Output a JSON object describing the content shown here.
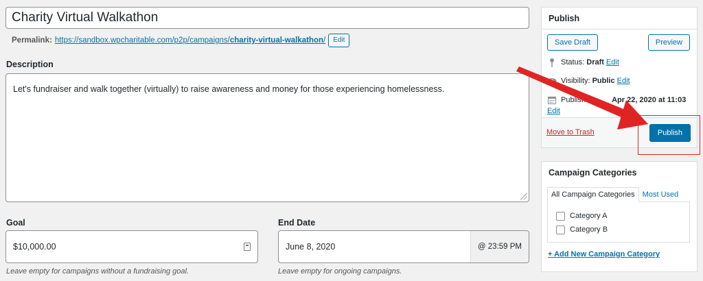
{
  "title": {
    "value": "Charity Virtual Walkathon"
  },
  "permalink": {
    "label": "Permalink:",
    "url_base": "https://sandbox.wpcharitable.com/p2p/campaigns/",
    "slug": "charity-virtual-walkathon",
    "url_trailing": "/",
    "edit_label": "Edit"
  },
  "description": {
    "label": "Description",
    "text": "Let's fundraiser and walk together (virtually) to raise awareness and money for those experiencing homelessness."
  },
  "goal": {
    "label": "Goal",
    "value": "$10,000.00",
    "hint": "Leave empty for campaigns without a fundraising goal."
  },
  "end_date": {
    "label": "End Date",
    "value": "June 8, 2020",
    "time": "@ 23:59 PM",
    "hint": "Leave empty for ongoing campaigns."
  },
  "publish": {
    "title": "Publish",
    "save_draft": "Save Draft",
    "preview": "Preview",
    "status_label": "Status:",
    "status_value": "Draft",
    "visibility_label": "Visibility:",
    "visibility_value": "Public",
    "published_label": "Publish",
    "published_value": "Apr 22, 2020 at 11:03",
    "edit": "Edit",
    "trash": "Move to Trash",
    "publish_button": "Publish"
  },
  "categories": {
    "title": "Campaign Categories",
    "tab_all": "All Campaign Categories",
    "tab_used": "Most Used",
    "items": [
      "Category A",
      "Category B"
    ],
    "add_new": "+ Add New Campaign Category"
  },
  "colors": {
    "accent": "#0073aa",
    "annotation": "#e02424",
    "danger": "#b32d2e"
  }
}
